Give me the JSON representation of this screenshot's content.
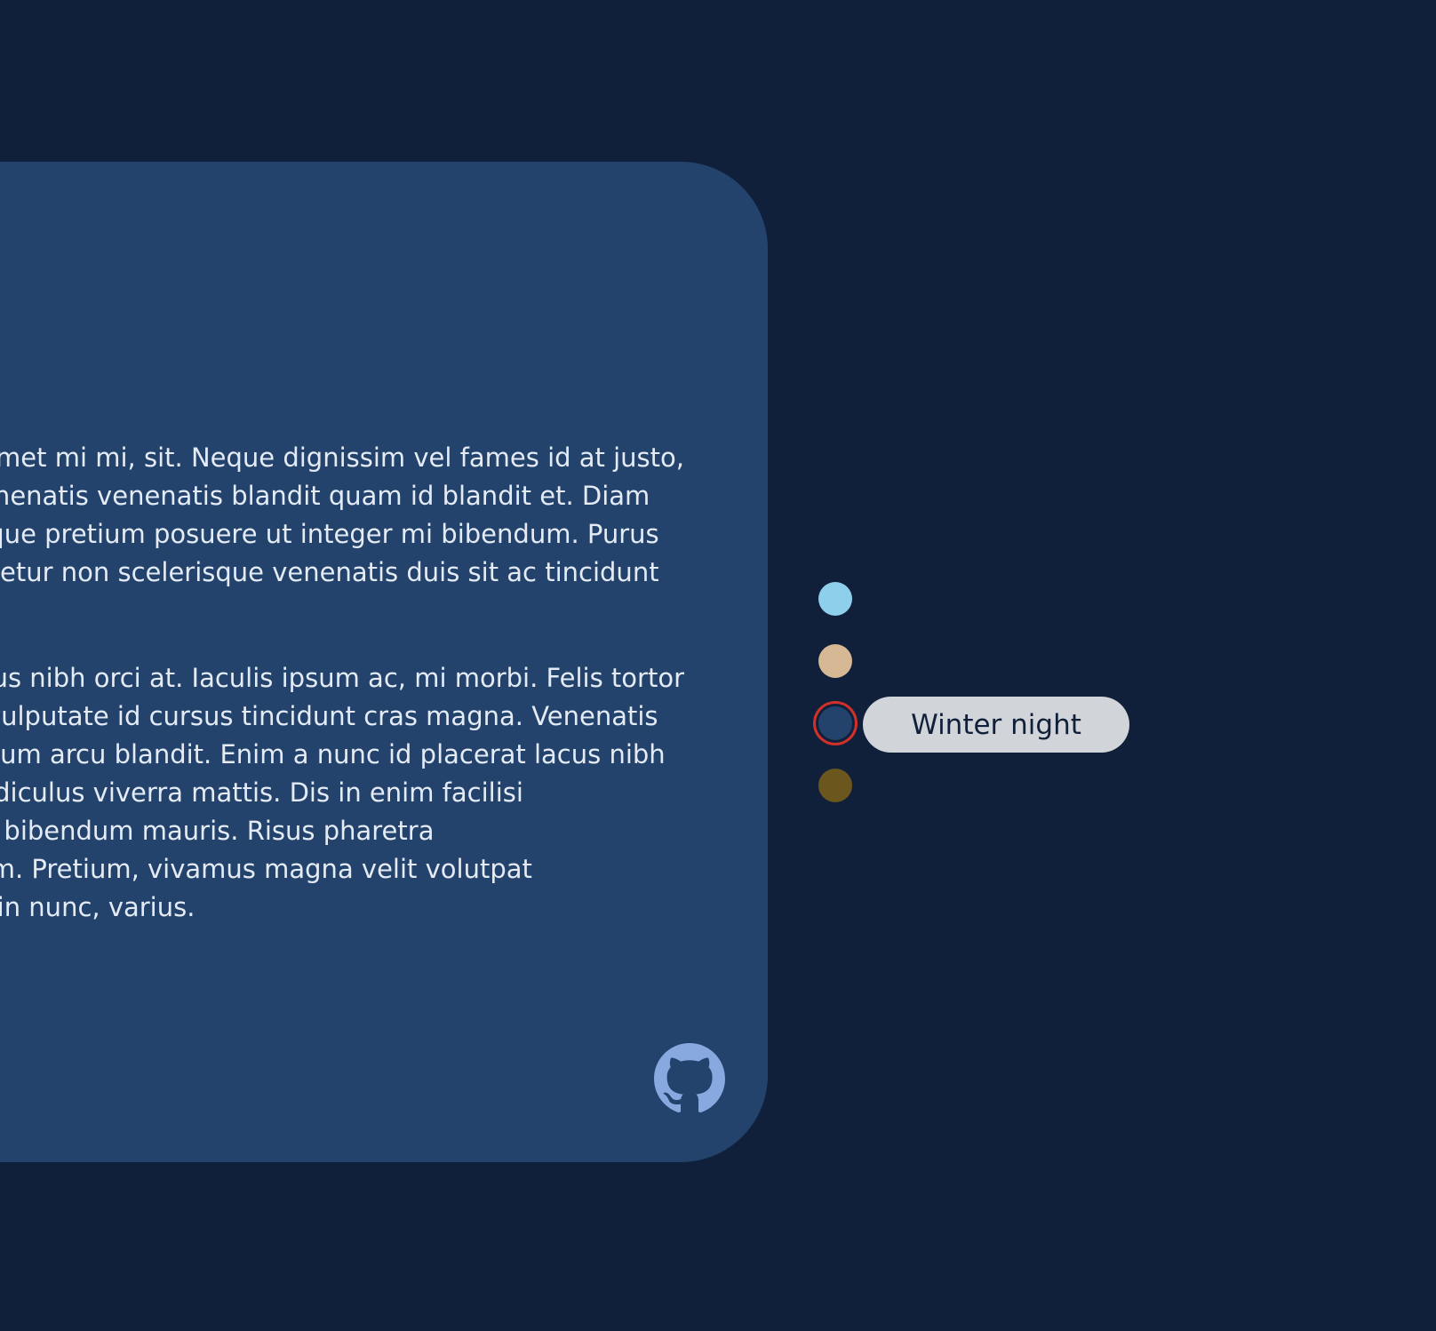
{
  "card": {
    "paragraphs": [
      [
        "Lorem ipsum dolor sit amet, sed tincidunt sed sit amet mi mi, sit. Neque dignissim vel fames id at justo,",
        "dictum facilisis at faucibus. Tortor vitae egestas venenatis venenatis blandit quam id blandit et. Diam",
        "tempus volutpat convallis, in pulvinar elit, scelerisque pretium posuere ut integer mi bibendum. Purus",
        "aliquam tincidunt, nibh eget ut, vitae vitae consectetur non scelerisque venenatis duis sit ac tincidunt"
      ],
      [
        "Morbi sed porttitor integer tincidunt, lacus at cursus nibh orci at. Iaculis ipsum ac, mi morbi. Felis tortor",
        "diam ultricies, ultrices quam amet sodales enim, vulputate id cursus tincidunt cras magna. Venenatis",
        "posuere at et pellentesque faucibus, at in elementum arcu blandit. Enim a nunc id placerat lacus nibh",
        "tellus aliquam lorem, sagittis nulla pellentesque ridiculus viverra mattis. Dis in enim facilisi",
        "condimentum donec etiam ac erat, placerat justo, bibendum mauris. Risus pharetra",
        "scelerisque ac. Eros, at diam varius posuere rutrum. Pretium, vivamus magna velit volutpat",
        "lectus mauris, quis nunc orci elementum sollicitudin nunc, varius."
      ]
    ],
    "github_icon": "github-icon"
  },
  "themes": {
    "swatches": [
      {
        "color": "#8ecfeb",
        "selected": false
      },
      {
        "color": "#d6b894",
        "selected": false
      },
      {
        "color": "#23436c",
        "selected": true
      },
      {
        "color": "#6b561d",
        "selected": false
      }
    ],
    "tooltip_label": "Winter night",
    "selected_ring_color": "#d2312a"
  },
  "colors": {
    "page_background": "#11203a",
    "card_background": "#23436c",
    "text": "#e4ebf5",
    "github_icon": "#88a8e0",
    "tooltip_background": "#d1d5da"
  }
}
